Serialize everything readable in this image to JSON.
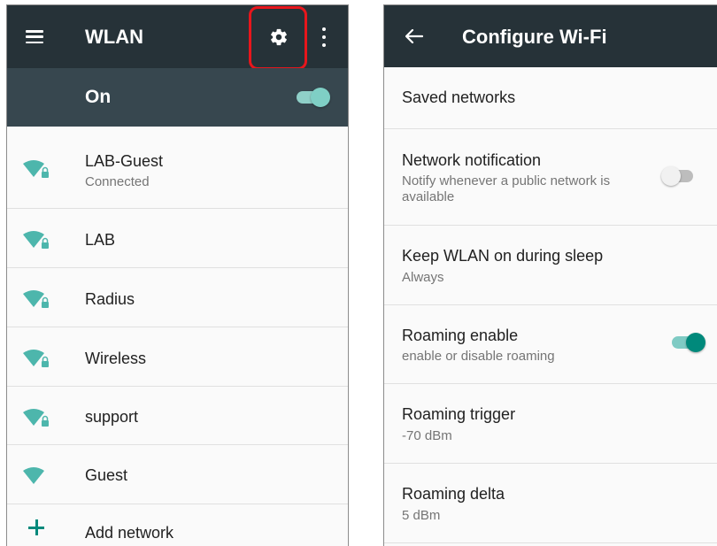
{
  "wlan_screen": {
    "title": "WLAN",
    "master": {
      "label": "On",
      "enabled": true
    },
    "networks": [
      {
        "name": "LAB-Guest",
        "status": "Connected",
        "secured": true
      },
      {
        "name": "LAB",
        "secured": true
      },
      {
        "name": "Radius",
        "secured": true
      },
      {
        "name": "Wireless",
        "secured": true
      },
      {
        "name": "support",
        "secured": true
      },
      {
        "name": "Guest",
        "secured": false
      }
    ],
    "add_network_label": "Add network",
    "icons": {
      "menu": "hamburger-menu-icon",
      "settings": "gear-icon",
      "more": "overflow-menu-icon",
      "wifi": "wifi-signal-icon",
      "lock": "lock-icon",
      "add": "plus-icon"
    },
    "highlight_color": "#e8161c"
  },
  "configure_screen": {
    "title": "Configure Wi-Fi",
    "prefs": [
      {
        "title": "Saved networks",
        "summary": ""
      },
      {
        "title": "Network notification",
        "summary": "Notify whenever a public network is available",
        "toggle": false
      },
      {
        "title": "Keep WLAN on during sleep",
        "summary": "Always"
      },
      {
        "title": "Roaming enable",
        "summary": "enable or disable roaming",
        "toggle": true
      },
      {
        "title": "Roaming trigger",
        "summary": "-70 dBm"
      },
      {
        "title": "Roaming delta",
        "summary": "5 dBm"
      }
    ],
    "icons": {
      "back": "arrow-back-icon"
    }
  },
  "colors": {
    "toolbar": "#263238",
    "master_bar": "#37474f",
    "accent": "#00897b",
    "wifi_icon": "#4db6ac"
  }
}
